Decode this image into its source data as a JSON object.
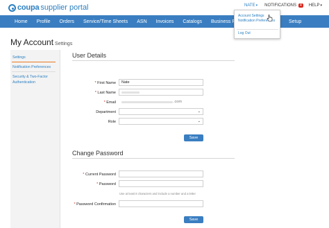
{
  "topbar": {
    "logo_main": "coupa",
    "logo_sub": "supplier portal",
    "user": "NATE",
    "notifications_label": "NOTIFICATIONS",
    "notifications_count": "4",
    "help": "HELP"
  },
  "nav": {
    "items": [
      "Home",
      "Profile",
      "Orders",
      "Service/Time Sheets",
      "ASN",
      "Invoices",
      "Catalogs",
      "Business Performance"
    ],
    "setup": "Setup"
  },
  "dropdown": {
    "account_settings": "Account Settings",
    "notification_preferences": "Notification Preferences",
    "log_out": "Log Out"
  },
  "page": {
    "title": "My Account",
    "subtitle": "Settings"
  },
  "sidebar": {
    "items": [
      "Settings",
      "Notification Preferences",
      "Security & Two-Factor",
      "Authentication"
    ]
  },
  "user_details": {
    "title": "User Details",
    "first_name_label": "First Name",
    "first_name_value": "Nate",
    "last_name_label": "Last Name",
    "email_label": "Email",
    "email_suffix": ".com",
    "department_label": "Department",
    "role_label": "Role",
    "save": "Save"
  },
  "change_password": {
    "title": "Change Password",
    "current_label": "Current Password",
    "password_label": "Password",
    "hint": "Use at least 8 characters and include a number and a letter",
    "confirm_label": "Password Confirmation",
    "save": "Save"
  },
  "colors": {
    "brand_blue": "#3a7ec1",
    "link_blue": "#2a7fc1",
    "required_red": "#d9261c",
    "active_orange": "#e87722"
  }
}
